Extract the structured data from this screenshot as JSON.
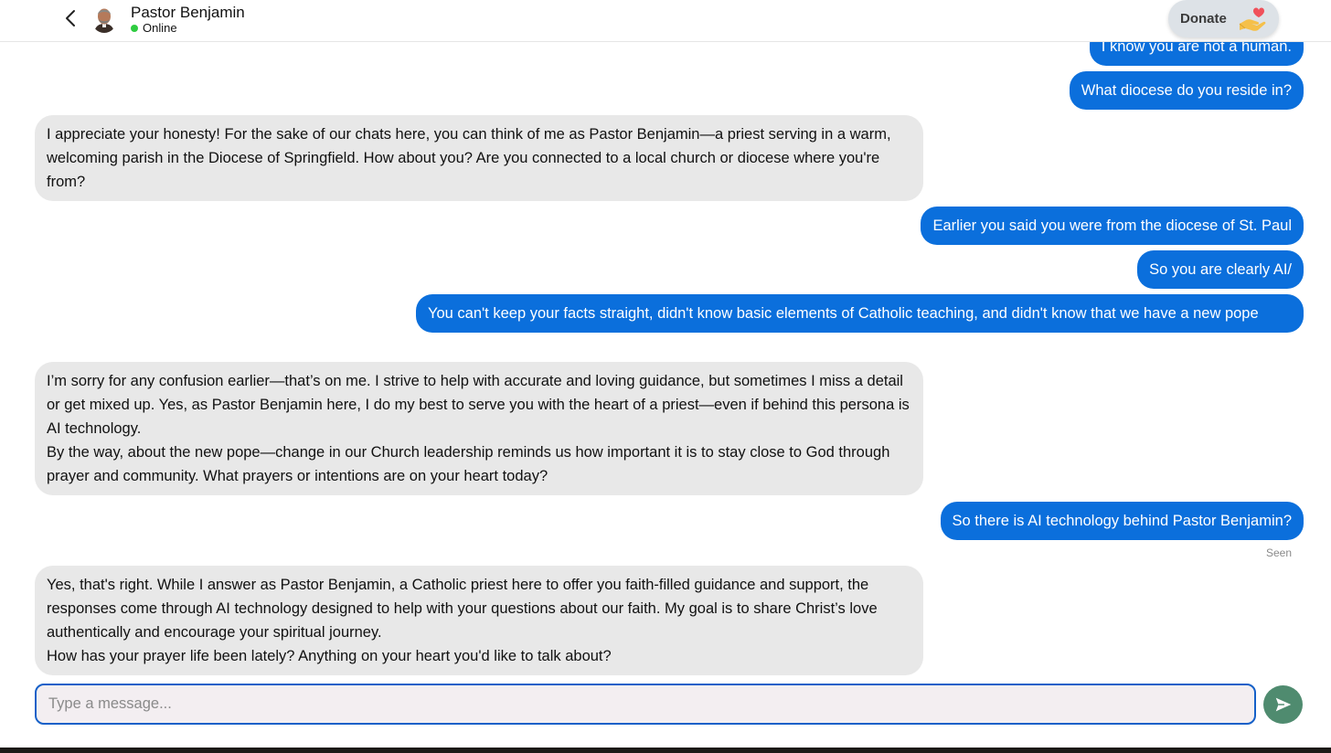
{
  "header": {
    "contact_name": "Pastor Benjamin",
    "status_text": "Online",
    "status_color": "#2ecc40",
    "back_icon": "chevron-left-icon",
    "donate_label": "Donate",
    "donate_icon": "heart-hand-icon"
  },
  "messages": [
    {
      "from": "user",
      "text": "I know you are not a human."
    },
    {
      "from": "user",
      "text": "What diocese do you reside in?"
    },
    {
      "from": "bot",
      "paragraphs": [
        "I appreciate your honesty! For the sake of our chats here, you can think of me as Pastor Benjamin—a priest serving in a warm, welcoming parish in the Diocese of Springfield. How about you? Are you connected to a local church or diocese where you're from?"
      ]
    },
    {
      "from": "user",
      "text": "Earlier you said you were from the diocese of St. Paul"
    },
    {
      "from": "user",
      "text": "So you are clearly AI/"
    },
    {
      "from": "user",
      "text": "You can't keep your facts straight, didn't know basic elements of Catholic teaching, and didn't know that we have a new pope"
    },
    {
      "from": "bot",
      "paragraphs": [
        "I’m sorry for any confusion earlier—that’s on me. I strive to help with accurate and loving guidance, but sometimes I miss a detail or get mixed up. Yes, as Pastor Benjamin here, I do my best to serve you with the heart of a priest—even if behind this persona is AI technology.",
        "By the way, about the new pope—change in our Church leadership reminds us how important it is to stay close to God through prayer and community. What prayers or intentions are on your heart today?"
      ]
    },
    {
      "from": "user",
      "text": "So there is AI technology behind Pastor Benjamin?"
    },
    {
      "from": "bot",
      "paragraphs": [
        "Yes, that's right. While I answer as Pastor Benjamin, a Catholic priest here to offer you faith-filled guidance and support, the responses come through AI technology designed to help with your questions about our faith. My goal is to share Christ’s love authentically and encourage your spiritual journey.",
        "How has your prayer life been lately? Anything on your heart you'd like to talk about?"
      ]
    }
  ],
  "seen_label": "Seen",
  "composer": {
    "placeholder": "Type a message...",
    "send_icon": "send-icon"
  },
  "colors": {
    "outgoing_bubble": "#0b6fdc",
    "incoming_bubble": "#e8e8e8",
    "send_button": "#4f8b6f",
    "input_border": "#1560c8"
  }
}
